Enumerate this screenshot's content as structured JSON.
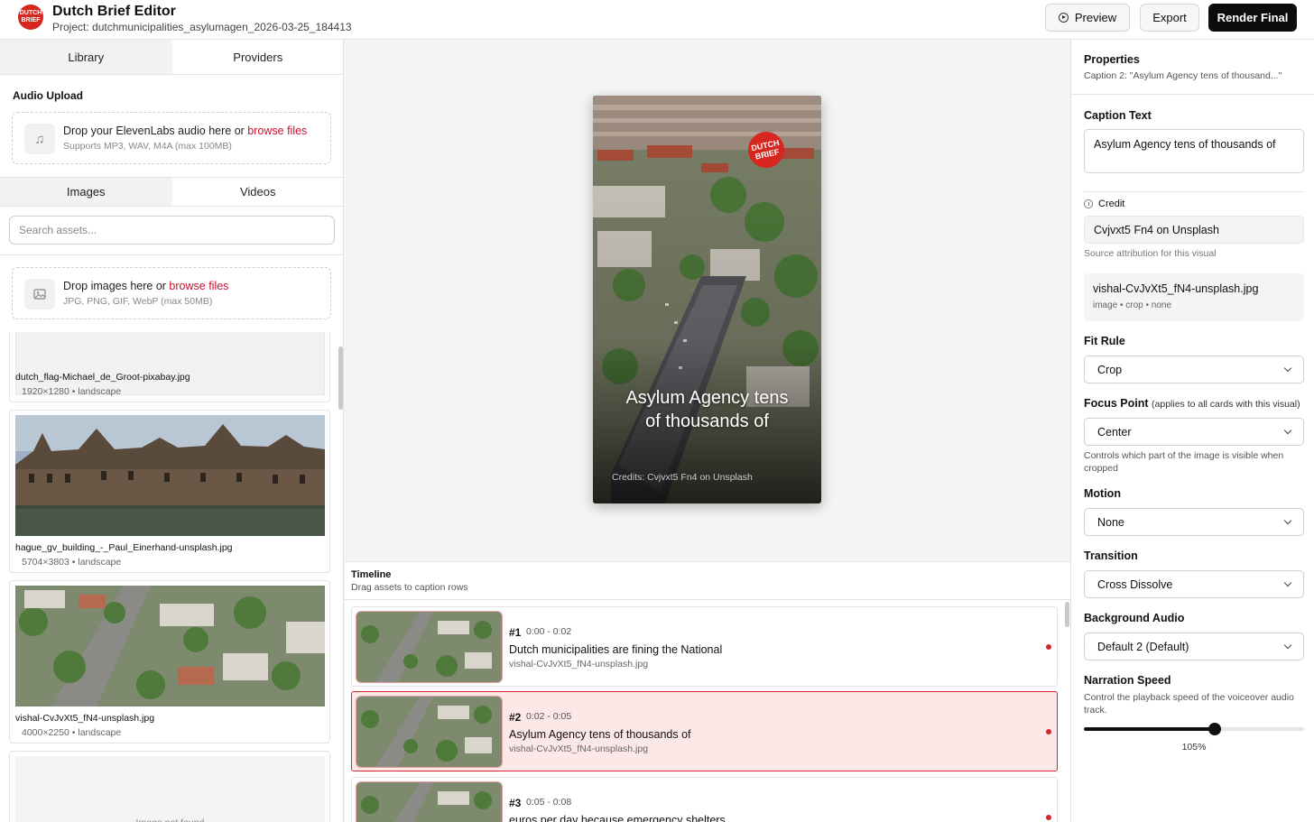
{
  "header": {
    "logo_text": "DUTCH BRIEF",
    "title": "Dutch Brief Editor",
    "project": "Project: dutchmunicipalities_asylumagen_2026-03-25_184413",
    "preview_label": "Preview",
    "export_label": "Export",
    "render_label": "Render Final"
  },
  "left": {
    "tabs": [
      "Library",
      "Providers"
    ],
    "audio_section": "Audio Upload",
    "audio_drop": {
      "text": "Drop your ElevenLabs audio here or ",
      "link": "browse files",
      "hint": "Supports MP3, WAV, M4A (max 100MB)"
    },
    "asset_tabs": [
      "Images",
      "Videos"
    ],
    "search_placeholder": "Search assets...",
    "image_drop": {
      "text": "Drop images here or ",
      "link": "browse files",
      "hint": "JPG, PNG, GIF, WebP (max 50MB)"
    },
    "assets": [
      {
        "name": "dutch_flag-Michael_de_Groot-pixabay.jpg",
        "meta": "1920×1280 • landscape"
      },
      {
        "name": "hague_gv_building_-_Paul_Einerhand-unsplash.jpg",
        "meta": "5704×3803 • landscape"
      },
      {
        "name": "vishal-CvJvXt5_fN4-unsplash.jpg",
        "meta": "4000×2250 • landscape"
      },
      {
        "not_found": "Image not found"
      }
    ]
  },
  "preview": {
    "logo_text": "DUTCH BRIEF",
    "caption_line1": "Asylum Agency tens",
    "caption_line2": "of thousands of",
    "credits": "Credits: Cvjvxt5 Fn4 on Unsplash"
  },
  "timeline": {
    "title": "Timeline",
    "subtitle": "Drag assets to caption rows",
    "rows": [
      {
        "num": "#1",
        "time": "0:00 - 0:02",
        "text": "Dutch municipalities are fining the National",
        "file": "vishal-CvJvXt5_fN4-unsplash.jpg"
      },
      {
        "num": "#2",
        "time": "0:02 - 0:05",
        "text": "Asylum Agency tens of thousands of",
        "file": "vishal-CvJvXt5_fN4-unsplash.jpg"
      },
      {
        "num": "#3",
        "time": "0:05 - 0:08",
        "text": "euros per day because emergency shelters",
        "file": ""
      }
    ]
  },
  "properties": {
    "title": "Properties",
    "subtitle": "Caption 2: \"Asylum Agency tens of thousand...\"",
    "caption_label": "Caption Text",
    "caption_value": "Asylum Agency tens of thousands of",
    "credit_label": "Credit",
    "credit_value": "Cvjvxt5 Fn4 on Unsplash",
    "credit_hint": "Source attribution for this visual",
    "file_name": "vishal-CvJvXt5_fN4-unsplash.jpg",
    "file_meta": "image • crop • none",
    "fit_label": "Fit Rule",
    "fit_value": "Crop",
    "focus_label": "Focus Point",
    "focus_hint": "(applies to all cards with this visual)",
    "focus_value": "Center",
    "focus_desc": "Controls which part of the image is visible when cropped",
    "motion_label": "Motion",
    "motion_value": "None",
    "transition_label": "Transition",
    "transition_value": "Cross Dissolve",
    "bg_audio_label": "Background Audio",
    "bg_audio_value": "Default 2 (Default)",
    "speed_label": "Narration Speed",
    "speed_desc": "Control the playback speed of the voiceover audio track.",
    "speed_value": "105%",
    "speed_fraction": 0.595
  },
  "colors": {
    "brand": "#d7261e",
    "accent": "#c8102e",
    "active_row": "#fde8e8"
  }
}
